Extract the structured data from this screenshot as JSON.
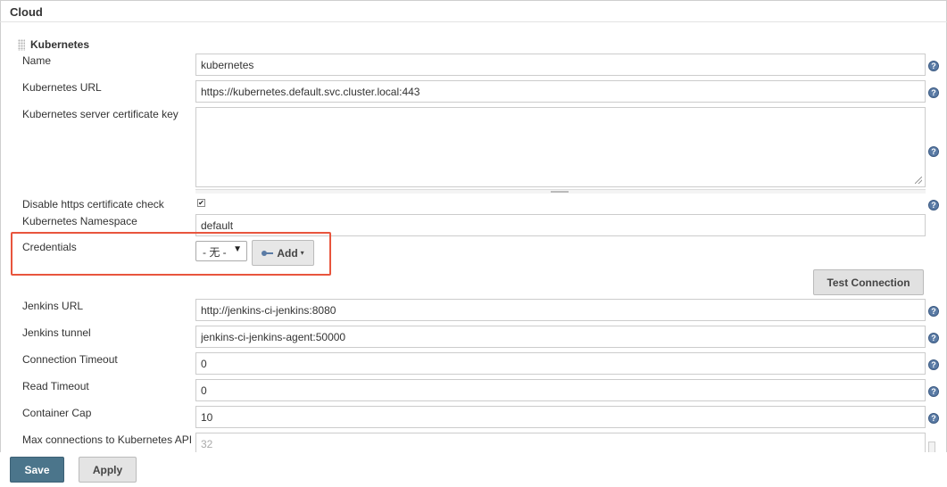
{
  "section": {
    "title": "Cloud"
  },
  "cloud": {
    "title": "Kubernetes"
  },
  "fields": {
    "name": {
      "label": "Name",
      "value": "kubernetes"
    },
    "kubernetes_url": {
      "label": "Kubernetes URL",
      "value": "https://kubernetes.default.svc.cluster.local:443"
    },
    "server_cert_key": {
      "label": "Kubernetes server certificate key",
      "value": ""
    },
    "disable_https_check": {
      "label": "Disable https certificate check",
      "checked": true,
      "check_glyph": "✔"
    },
    "namespace": {
      "label": "Kubernetes Namespace",
      "value": "default"
    },
    "credentials": {
      "label": "Credentials",
      "selected": "- 无 -",
      "caret": "▼"
    },
    "jenkins_url": {
      "label": "Jenkins URL",
      "value": "http://jenkins-ci-jenkins:8080"
    },
    "jenkins_tunnel": {
      "label": "Jenkins tunnel",
      "value": "jenkins-ci-jenkins-agent:50000"
    },
    "connection_timeout": {
      "label": "Connection Timeout",
      "value": "0"
    },
    "read_timeout": {
      "label": "Read Timeout",
      "value": "0"
    },
    "container_cap": {
      "label": "Container Cap",
      "value": "10"
    },
    "max_connections": {
      "label": "Max connections to Kubernetes API",
      "value": "32"
    }
  },
  "buttons": {
    "add": "Add",
    "add_caret": "▾",
    "test_connection": "Test Connection",
    "save": "Save",
    "apply": "Apply"
  },
  "help_glyph": "?",
  "colors": {
    "save_bg": "#4b758b",
    "highlight_border": "#e8553d",
    "help_icon": "#5a7ba5"
  }
}
